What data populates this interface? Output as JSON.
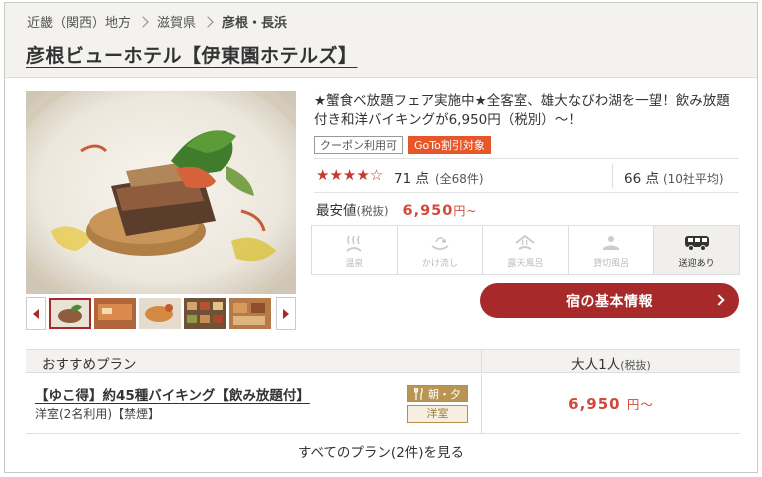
{
  "breadcrumb": {
    "items": [
      "近畿（関西）地方",
      "滋賀県",
      "彦根・長浜"
    ]
  },
  "hotel": {
    "name": "彦根ビューホテル【伊東園ホテルズ】",
    "description": "★蟹食べ放題フェア実施中★全客室、雄大なびわ湖を一望！飲み放題付き和洋バイキングが6,950円（税別）～！",
    "tags": [
      "クーポン利用可",
      "GoTo割引対象"
    ]
  },
  "rating": {
    "stars_text": "★★★★☆",
    "stars_value": 3.5,
    "score": "71 点",
    "review_count": "(全68件)",
    "avg_score": "66 点",
    "avg_label": "(10社平均)"
  },
  "price": {
    "label": "最安値",
    "tax_note": "(税抜)",
    "value": "6,950",
    "unit": "円~"
  },
  "amenities": [
    {
      "icon": "onsen-icon",
      "label": "温泉",
      "active": false
    },
    {
      "icon": "kakenagashi-icon",
      "label": "かけ流し",
      "active": false
    },
    {
      "icon": "rotenburo-icon",
      "label": "露天風呂",
      "active": false
    },
    {
      "icon": "private-bath-icon",
      "label": "貸切風呂",
      "active": false
    },
    {
      "icon": "shuttle-bus-icon",
      "label": "送迎あり",
      "active": true
    }
  ],
  "info_button": "宿の基本情報",
  "plans": {
    "header_label": "おすすめプラン",
    "header_price": "大人1人",
    "header_price_note": "(税抜)",
    "items": [
      {
        "title": "【ゆこ得】約45種バイキング【飲み放題付】",
        "subtitle": "洋室(2名利用)【禁煙】",
        "meal": "朝・夕",
        "room_type": "洋室",
        "price": "6,950",
        "unit": "円～"
      }
    ],
    "all_plans_link": "すべてのプラン(2件)を見る"
  },
  "colors": {
    "accent": "#a8292a",
    "price": "#d24a3b",
    "goto_tag": "#e8572a",
    "meal_badge": "#b99453"
  }
}
